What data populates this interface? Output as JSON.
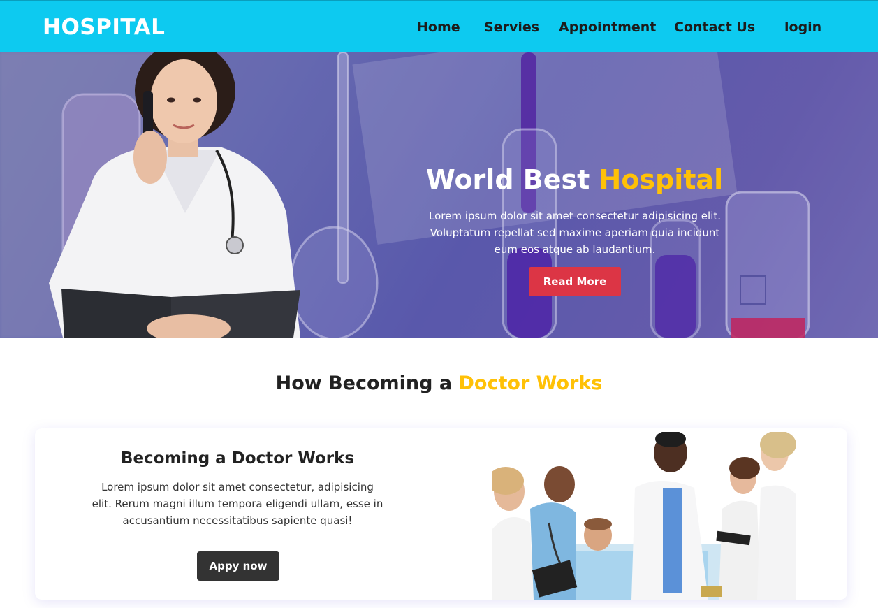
{
  "navbar": {
    "brand": "HOSPITAL",
    "links": [
      "Home",
      "Servies",
      "Appointment",
      "Contact Us",
      "login"
    ]
  },
  "hero": {
    "title_plain": "World Best ",
    "title_accent": "Hospital",
    "text": "Lorem ipsum dolor sit amet consectetur adipisicing elit. Voluptatum repellat sed maxime aperiam quia incidunt eum eos atque ab laudantium.",
    "button": "Read More"
  },
  "section": {
    "title_plain": "How Becoming a ",
    "title_accent": "Doctor Works"
  },
  "card": {
    "title": "Becoming a Doctor Works",
    "text": "Lorem ipsum dolor sit amet consectetur, adipisicing elit. Rerum magni illum tempora eligendi ullam, esse in accusantium necessitatibus sapiente quasi!",
    "button": "Appy now"
  },
  "colors": {
    "navbar": "#0dcaf0",
    "accent": "#ffc107",
    "primary_button": "#dc3545",
    "dark_button": "#333333"
  }
}
